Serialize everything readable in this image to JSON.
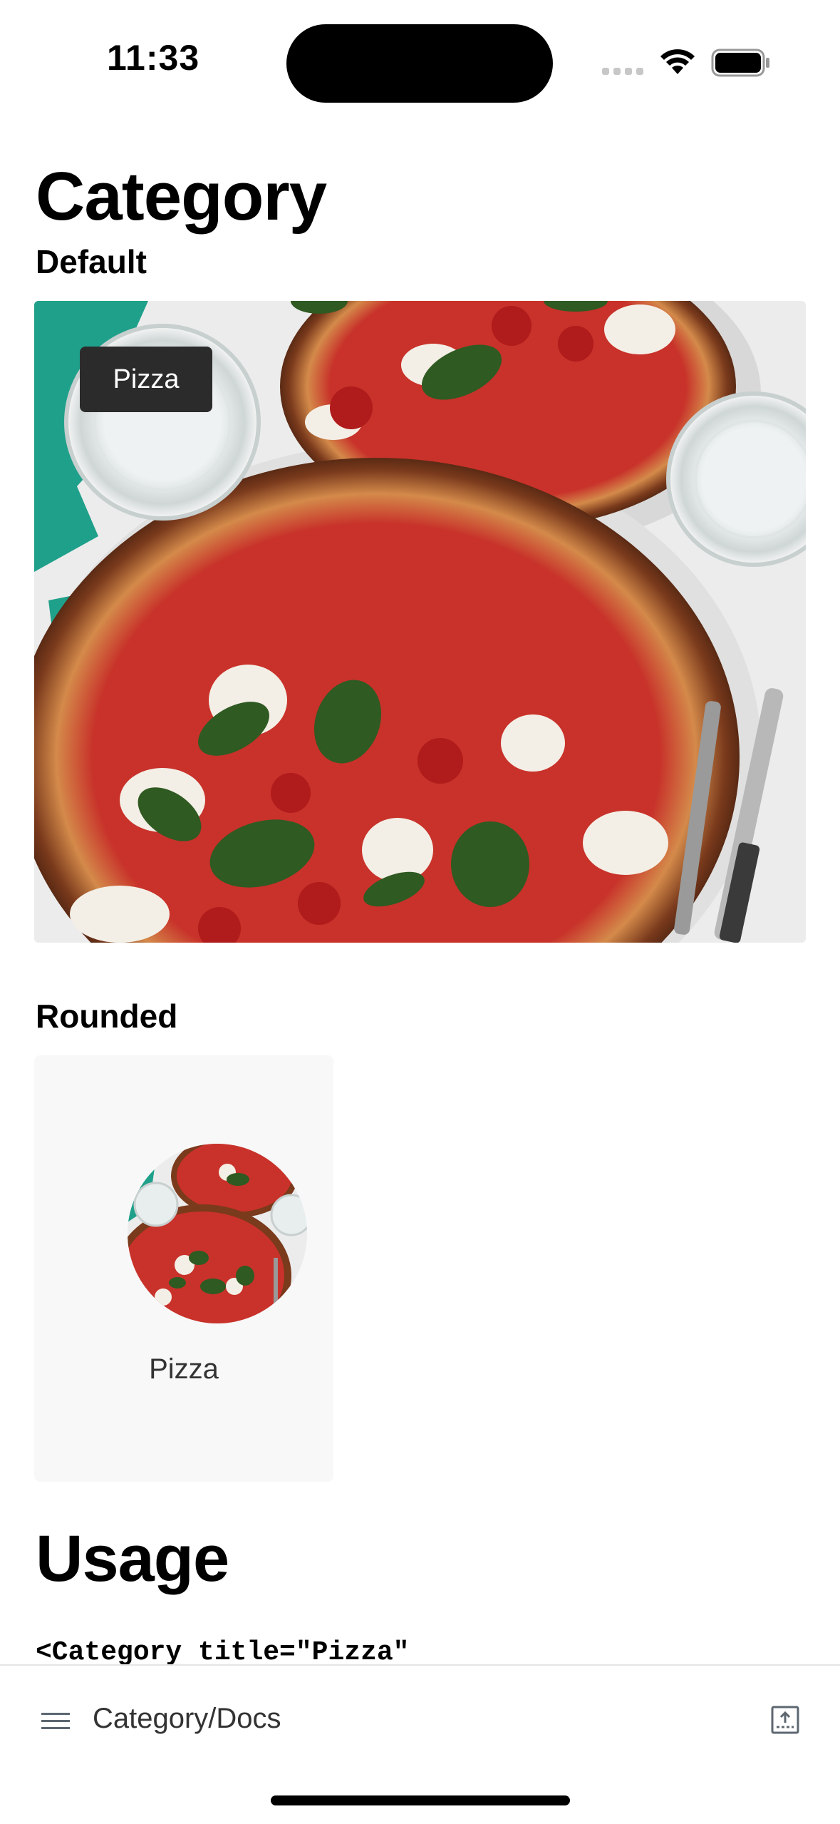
{
  "status": {
    "time": "11:33"
  },
  "page": {
    "title": "Category"
  },
  "sections": {
    "default_label": "Default",
    "rounded_label": "Rounded"
  },
  "category": {
    "title": "Pizza"
  },
  "usage": {
    "title": "Usage",
    "code": "<Category title=\"Pizza\""
  },
  "bottom_bar": {
    "title": "Category/Docs"
  },
  "icons": {
    "menu": "menu-icon",
    "panel": "panel-toggle-icon",
    "wifi": "wifi-icon",
    "battery": "battery-icon"
  }
}
